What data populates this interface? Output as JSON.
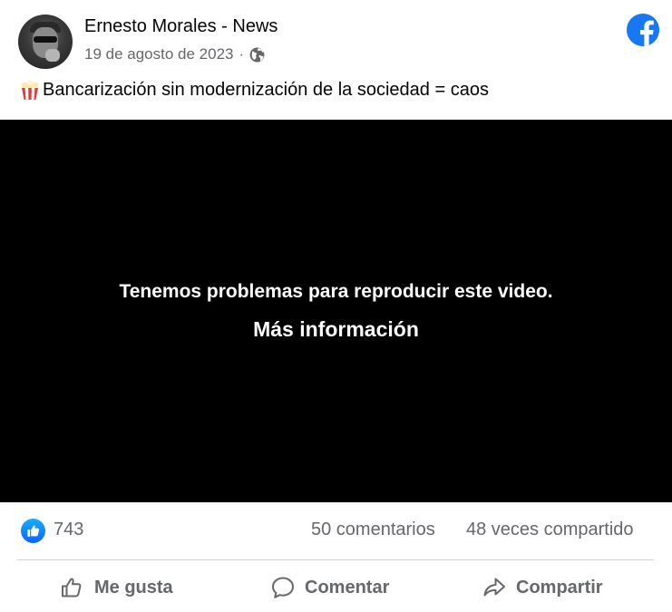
{
  "post": {
    "author": "Ernesto Morales - News",
    "date": "19 de agosto de 2023",
    "separator": "·",
    "text": "Bancarización sin modernización de la sociedad = caos"
  },
  "video": {
    "error_message": "Tenemos problemas para reproducir este video.",
    "more_info_link": "Más información"
  },
  "stats": {
    "likes": "743",
    "comments": "50 comentarios",
    "shares": "48 veces compartido"
  },
  "actions": {
    "like": "Me gusta",
    "comment": "Comentar",
    "share": "Compartir"
  },
  "colors": {
    "brand": "#1877f2",
    "secondary_text": "#65676b",
    "video_bg": "#000000"
  },
  "icons": {
    "avatar": "profile-photo",
    "privacy": "globe-icon",
    "brand": "facebook-logo-icon",
    "emoji": "popcorn-icon",
    "reaction": "like-reaction-icon",
    "like_action": "thumbs-up-icon",
    "comment_action": "speech-bubble-icon",
    "share_action": "share-arrow-icon"
  }
}
